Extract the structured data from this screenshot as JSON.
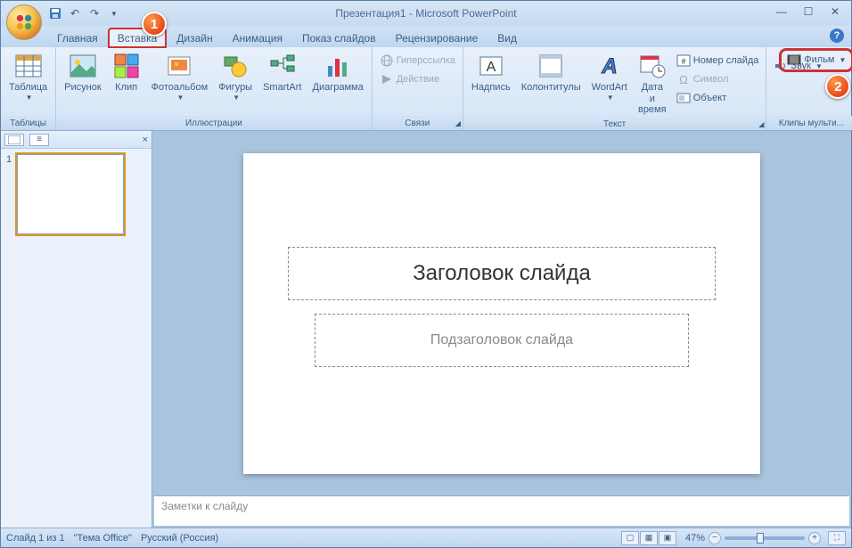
{
  "title": "Презентация1 - Microsoft PowerPoint",
  "tabs": {
    "home": "Главная",
    "insert": "Вставка",
    "design": "Дизайн",
    "anim": "Анимация",
    "show": "Показ слайдов",
    "review": "Рецензирование",
    "view": "Вид"
  },
  "ribbon": {
    "tables": {
      "table": "Таблица",
      "label": "Таблицы"
    },
    "illus": {
      "pic": "Рисунок",
      "clip": "Клип",
      "album": "Фотоальбом",
      "shapes": "Фигуры",
      "smartart": "SmartArt",
      "chart": "Диаграмма",
      "label": "Иллюстрации"
    },
    "links": {
      "hyper": "Гиперссылка",
      "action": "Действие",
      "label": "Связи"
    },
    "text": {
      "textbox": "Надпись",
      "headerfooter": "Колонтитулы",
      "wordart": "WordArt",
      "datetime": "Дата и время",
      "slidenum": "Номер слайда",
      "symbol": "Символ",
      "object": "Объект",
      "label": "Текст"
    },
    "media": {
      "movie": "Фильм",
      "sound": "Звук",
      "label": "Клипы мульти..."
    }
  },
  "slide": {
    "title": "Заголовок слайда",
    "subtitle": "Подзаголовок слайда"
  },
  "notes": {
    "placeholder": "Заметки к слайду"
  },
  "status": {
    "slide": "Слайд 1 из 1",
    "theme": "\"Тема Office\"",
    "lang": "Русский (Россия)",
    "zoom": "47%"
  },
  "markers": {
    "m1": "1",
    "m2": "2"
  },
  "thumb": {
    "num": "1"
  }
}
